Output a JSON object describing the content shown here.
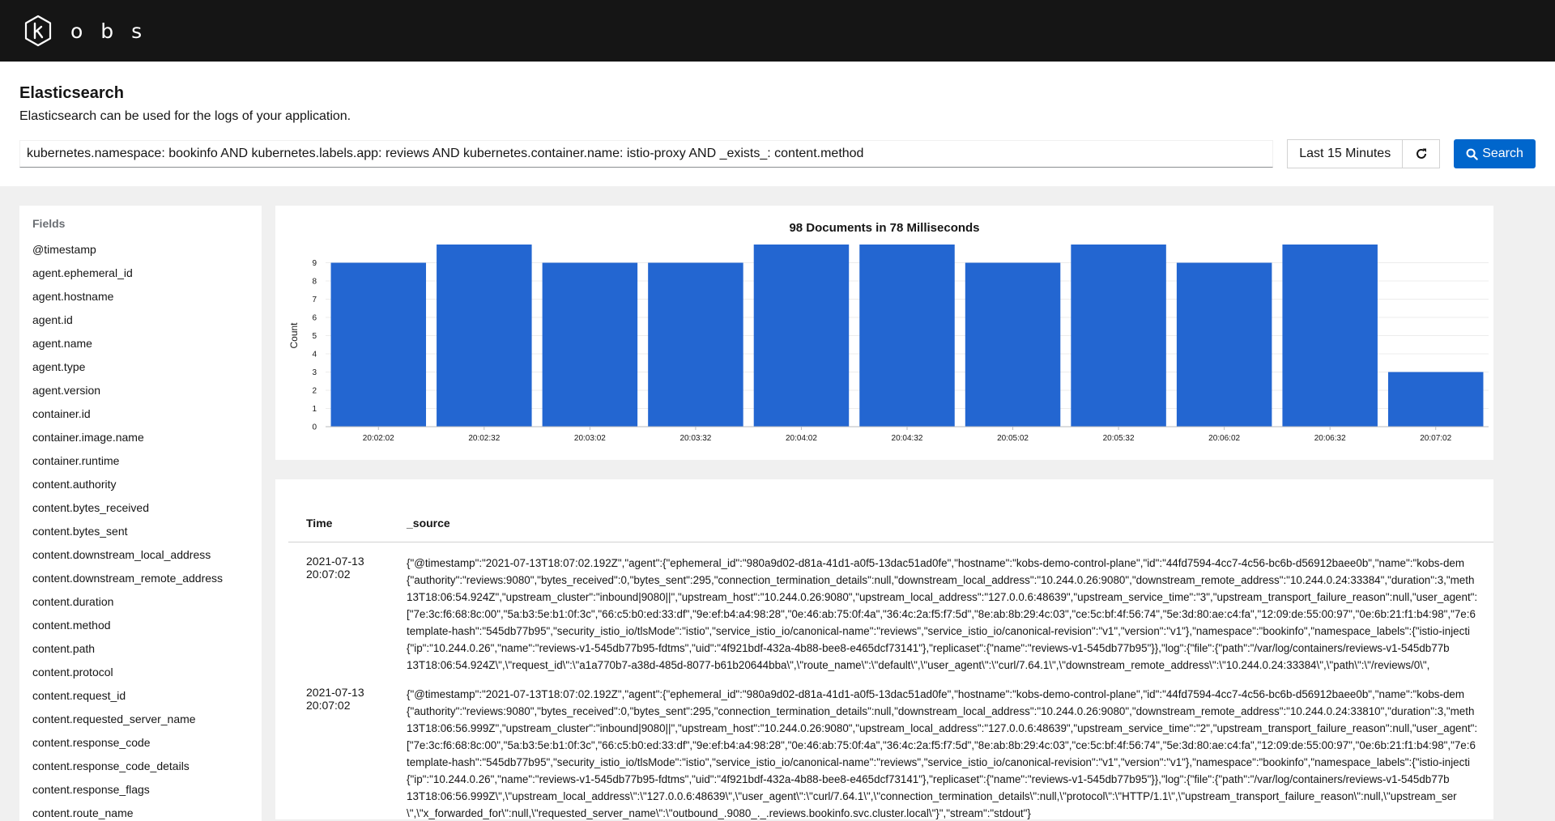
{
  "app": {
    "logo_letters": [
      "o",
      "b",
      "s"
    ]
  },
  "header": {
    "title": "Elasticsearch",
    "description": "Elasticsearch can be used for the logs of your application.",
    "query": "kubernetes.namespace: bookinfo AND kubernetes.labels.app: reviews AND kubernetes.container.name: istio-proxy AND _exists_: content.method",
    "time_range": "Last 15 Minutes",
    "search_label": "Search"
  },
  "fields": {
    "title": "Fields",
    "items": [
      "@timestamp",
      "agent.ephemeral_id",
      "agent.hostname",
      "agent.id",
      "agent.name",
      "agent.type",
      "agent.version",
      "container.id",
      "container.image.name",
      "container.runtime",
      "content.authority",
      "content.bytes_received",
      "content.bytes_sent",
      "content.downstream_local_address",
      "content.downstream_remote_address",
      "content.duration",
      "content.method",
      "content.path",
      "content.protocol",
      "content.request_id",
      "content.requested_server_name",
      "content.response_code",
      "content.response_code_details",
      "content.response_flags",
      "content.route_name"
    ]
  },
  "chart_data": {
    "type": "bar",
    "title": "98 Documents in 78 Milliseconds",
    "xlabel": "",
    "ylabel": "Count",
    "categories": [
      "20:02:02",
      "20:02:32",
      "20:03:02",
      "20:03:32",
      "20:04:02",
      "20:04:32",
      "20:05:02",
      "20:05:32",
      "20:06:02",
      "20:06:32",
      "20:07:02"
    ],
    "values": [
      9,
      10,
      9,
      9,
      10,
      10,
      9,
      10,
      9,
      10,
      3
    ],
    "ylim": [
      0,
      10
    ],
    "yticks": [
      0,
      1,
      2,
      3,
      4,
      5,
      6,
      7,
      8,
      9
    ],
    "grid": true,
    "bar_color": "#2366d1"
  },
  "logs": {
    "headers": {
      "time": "Time",
      "source": "_source"
    },
    "rows": [
      {
        "time": "2021-07-13 20:07:02",
        "lines": [
          "{\"@timestamp\":\"2021-07-13T18:07:02.192Z\",\"agent\":{\"ephemeral_id\":\"980a9d02-d81a-41d1-a0f5-13dac51ad0fe\",\"hostname\":\"kobs-demo-control-plane\",\"id\":\"44fd7594-4cc7-4c56-bc6b-d56912baee0b\",\"name\":\"kobs-dem",
          "{\"authority\":\"reviews:9080\",\"bytes_received\":0,\"bytes_sent\":295,\"connection_termination_details\":null,\"downstream_local_address\":\"10.244.0.26:9080\",\"downstream_remote_address\":\"10.244.0.24:33384\",\"duration\":3,\"meth",
          "13T18:06:54.924Z\",\"upstream_cluster\":\"inbound|9080||\",\"upstream_host\":\"10.244.0.26:9080\",\"upstream_local_address\":\"127.0.0.6:48639\",\"upstream_service_time\":\"3\",\"upstream_transport_failure_reason\":null,\"user_agent\":",
          "[\"7e:3c:f6:68:8c:00\",\"5a:b3:5e:b1:0f:3c\",\"66:c5:b0:ed:33:df\",\"9e:ef:b4:a4:98:28\",\"0e:46:ab:75:0f:4a\",\"36:4c:2a:f5:f7:5d\",\"8e:ab:8b:29:4c:03\",\"ce:5c:bf:4f:56:74\",\"5e:3d:80:ae:c4:fa\",\"12:09:de:55:00:97\",\"0e:6b:21:f1:b4:98\",\"7e:6",
          "template-hash\":\"545db77b95\",\"security_istio_io/tlsMode\":\"istio\",\"service_istio_io/canonical-name\":\"reviews\",\"service_istio_io/canonical-revision\":\"v1\",\"version\":\"v1\"},\"namespace\":\"bookinfo\",\"namespace_labels\":{\"istio-injecti",
          "{\"ip\":\"10.244.0.26\",\"name\":\"reviews-v1-545db77b95-fdtms\",\"uid\":\"4f921bdf-432a-4b88-bee8-e465dcf73141\"},\"replicaset\":{\"name\":\"reviews-v1-545db77b95\"}},\"log\":{\"file\":{\"path\":\"/var/log/containers/reviews-v1-545db77b",
          "13T18:06:54.924Z\\\",\\\"request_id\\\":\\\"a1a770b7-a38d-485d-8077-b61b20644bba\\\",\\\"route_name\\\":\\\"default\\\",\\\"user_agent\\\":\\\"curl/7.64.1\\\",\\\"downstream_remote_address\\\":\\\"10.244.0.24:33384\\\",\\\"path\\\":\\\"/reviews/0\\\","
        ]
      },
      {
        "time": "2021-07-13 20:07:02",
        "lines": [
          "{\"@timestamp\":\"2021-07-13T18:07:02.192Z\",\"agent\":{\"ephemeral_id\":\"980a9d02-d81a-41d1-a0f5-13dac51ad0fe\",\"hostname\":\"kobs-demo-control-plane\",\"id\":\"44fd7594-4cc7-4c56-bc6b-d56912baee0b\",\"name\":\"kobs-dem",
          "{\"authority\":\"reviews:9080\",\"bytes_received\":0,\"bytes_sent\":295,\"connection_termination_details\":null,\"downstream_local_address\":\"10.244.0.26:9080\",\"downstream_remote_address\":\"10.244.0.24:33810\",\"duration\":3,\"meth",
          "13T18:06:56.999Z\",\"upstream_cluster\":\"inbound|9080||\",\"upstream_host\":\"10.244.0.26:9080\",\"upstream_local_address\":\"127.0.0.6:48639\",\"upstream_service_time\":\"2\",\"upstream_transport_failure_reason\":null,\"user_agent\":",
          "[\"7e:3c:f6:68:8c:00\",\"5a:b3:5e:b1:0f:3c\",\"66:c5:b0:ed:33:df\",\"9e:ef:b4:a4:98:28\",\"0e:46:ab:75:0f:4a\",\"36:4c:2a:f5:f7:5d\",\"8e:ab:8b:29:4c:03\",\"ce:5c:bf:4f:56:74\",\"5e:3d:80:ae:c4:fa\",\"12:09:de:55:00:97\",\"0e:6b:21:f1:b4:98\",\"7e:6",
          "template-hash\":\"545db77b95\",\"security_istio_io/tlsMode\":\"istio\",\"service_istio_io/canonical-name\":\"reviews\",\"service_istio_io/canonical-revision\":\"v1\",\"version\":\"v1\"},\"namespace\":\"bookinfo\",\"namespace_labels\":{\"istio-injecti",
          "{\"ip\":\"10.244.0.26\",\"name\":\"reviews-v1-545db77b95-fdtms\",\"uid\":\"4f921bdf-432a-4b88-bee8-e465dcf73141\"},\"replicaset\":{\"name\":\"reviews-v1-545db77b95\"}},\"log\":{\"file\":{\"path\":\"/var/log/containers/reviews-v1-545db77b",
          "13T18:06:56.999Z\\\",\\\"upstream_local_address\\\":\\\"127.0.0.6:48639\\\",\\\"user_agent\\\":\\\"curl/7.64.1\\\",\\\"connection_termination_details\\\":null,\\\"protocol\\\":\\\"HTTP/1.1\\\",\\\"upstream_transport_failure_reason\\\":null,\\\"upstream_ser",
          "\\\",\\\"x_forwarded_for\\\":null,\\\"requested_server_name\\\":\\\"outbound_.9080_._.reviews.bookinfo.svc.cluster.local\\\"}\",\"stream\":\"stdout\"}"
        ]
      }
    ]
  }
}
